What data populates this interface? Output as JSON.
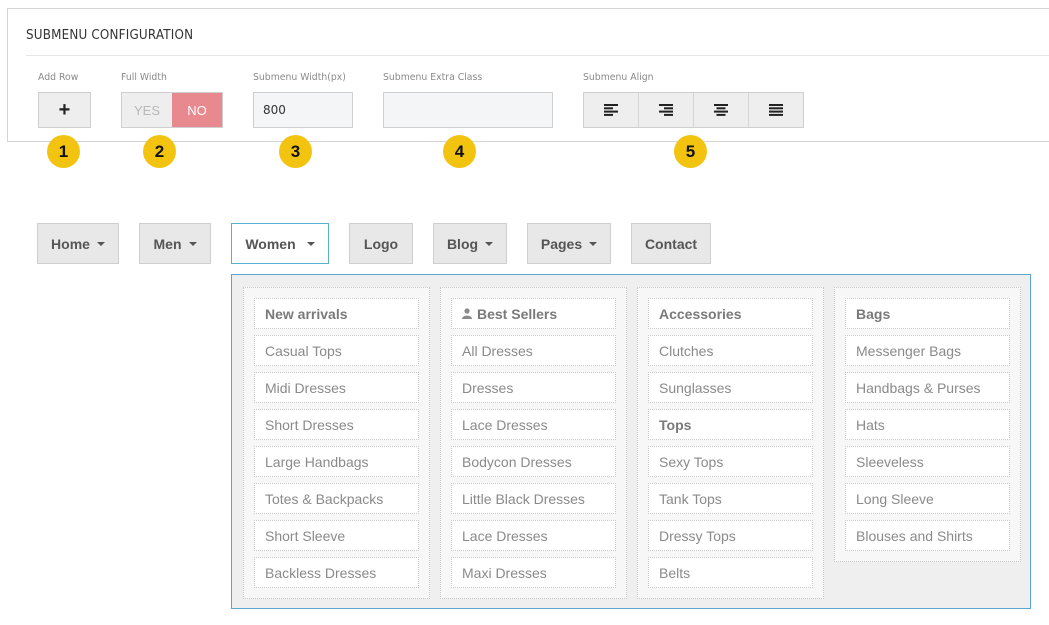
{
  "config": {
    "title": "SUBMENU CONFIGURATION",
    "add_row": {
      "label": "Add Row",
      "button": "+"
    },
    "full_width": {
      "label": "Full Width",
      "yes": "YES",
      "no": "NO",
      "selected": "NO"
    },
    "submenu_width": {
      "label": "Submenu Width(px)",
      "value": "800"
    },
    "extra_class": {
      "label": "Submenu Extra Class",
      "value": ""
    },
    "align": {
      "label": "Submenu Align",
      "options": [
        "align-left-icon",
        "align-right-icon",
        "align-center-icon",
        "align-justify-icon"
      ]
    }
  },
  "callouts": [
    "1",
    "2",
    "3",
    "4",
    "5"
  ],
  "nav": [
    {
      "label": "Home",
      "dropdown": true
    },
    {
      "label": "Men",
      "dropdown": true
    },
    {
      "label": "Women",
      "dropdown": true,
      "active": true
    },
    {
      "label": "Logo",
      "dropdown": false
    },
    {
      "label": "Blog",
      "dropdown": true
    },
    {
      "label": "Pages",
      "dropdown": true
    },
    {
      "label": "Contact",
      "dropdown": false
    }
  ],
  "submenu": {
    "columns": [
      {
        "items": [
          "New arrivals",
          "Casual Tops",
          "Midi Dresses",
          "Short Dresses",
          "Large Handbags",
          "Totes & Backpacks",
          "Short Sleeve",
          "Backless Dresses"
        ],
        "headers": [
          0
        ]
      },
      {
        "items": [
          "Best Sellers",
          "All Dresses",
          "Dresses",
          "Lace Dresses",
          "Bodycon Dresses",
          "Little Black Dresses",
          "Lace Dresses",
          "Maxi Dresses"
        ],
        "headers": [
          0
        ],
        "header_icon": "user-icon"
      },
      {
        "items": [
          "Accessories",
          "Clutches",
          "Sunglasses",
          "Tops",
          "Sexy Tops",
          "Tank Tops",
          "Dressy Tops",
          "Belts"
        ],
        "headers": [
          0,
          3
        ]
      },
      {
        "items": [
          "Bags",
          "Messenger Bags",
          "Handbags & Purses",
          "Hats",
          "Sleeveless",
          "Long Sleeve",
          "Blouses and Shirts"
        ],
        "headers": [
          0
        ]
      }
    ]
  },
  "colors": {
    "toggle_no": "#e8898f",
    "badge": "#f2c40f",
    "active_border": "#5ba6cf"
  }
}
